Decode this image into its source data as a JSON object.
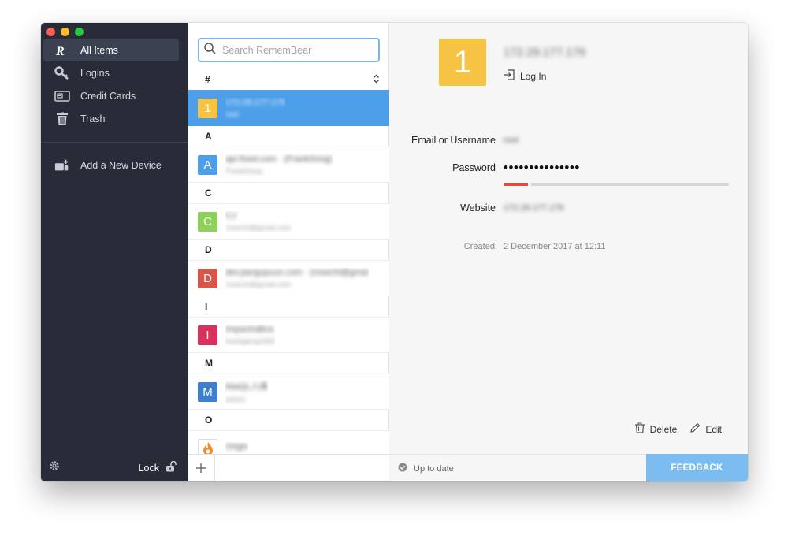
{
  "sidebar": {
    "items": [
      {
        "label": "All Items",
        "icon": "rememberbear-logo-icon",
        "active": true
      },
      {
        "label": "Logins",
        "icon": "key-icon"
      },
      {
        "label": "Credit Cards",
        "icon": "credit-card-icon"
      },
      {
        "label": "Trash",
        "icon": "trash-icon"
      }
    ],
    "add_device_label": "Add a New Device",
    "lock_label": "Lock"
  },
  "search": {
    "placeholder": "Search RememBear"
  },
  "list": {
    "sections": [
      {
        "header": "#",
        "rows": [
          {
            "letter": "1",
            "title": "172.29.177.176",
            "sub": "root"
          }
        ]
      },
      {
        "header": "A",
        "rows": [
          {
            "letter": "A",
            "title": "api.fixed.com · (FrankSong)",
            "sub": "FrankSong"
          }
        ]
      },
      {
        "header": "C",
        "rows": [
          {
            "letter": "C",
            "title": "CJ",
            "sub": "rosechi@gmail.com"
          }
        ]
      },
      {
        "header": "D",
        "rows": [
          {
            "letter": "D",
            "title": "dev.jiangupuun.com · (rosechi@gmai",
            "sub": "rosechi@gmail.com"
          }
        ]
      },
      {
        "header": "I",
        "rows": [
          {
            "letter": "I",
            "title": "ImpactraBus",
            "sub": "frankgeng1993"
          }
        ]
      },
      {
        "header": "M",
        "rows": [
          {
            "letter": "M",
            "title": "MaiQL入库",
            "sub": "admin"
          }
        ]
      },
      {
        "header": "O",
        "rows": [
          {
            "letter": "",
            "title": "Origin",
            "sub": ""
          }
        ]
      }
    ]
  },
  "detail": {
    "avatar_letter": "1",
    "title": "172.29.177.176",
    "login_label": "Log In",
    "fields": {
      "email_label": "Email or Username",
      "email_value": "root",
      "password_label": "Password",
      "password_value": "•••••••••••••••",
      "website_label": "Website",
      "website_value": "172.29.177.176"
    },
    "password_strength": 0.11,
    "created_label": "Created:",
    "created_value": "2 December 2017 at 12:11",
    "delete_label": "Delete",
    "edit_label": "Edit"
  },
  "footer": {
    "status": "Up to date",
    "feedback": "FEEDBACK"
  },
  "colors": {
    "sidebar_bg": "#272c38",
    "selected_row": "#4e9fea",
    "feedback_bg": "#7bbdf0",
    "avatar_1": "#f7c344",
    "avatar_A": "#4e9fea",
    "avatar_C": "#8ed05a",
    "avatar_D": "#d9554a",
    "avatar_I": "#d6325d",
    "avatar_M": "#3f7fcf",
    "avatar_O": "#f08b2e",
    "strength_weak": "#e24b3b"
  }
}
